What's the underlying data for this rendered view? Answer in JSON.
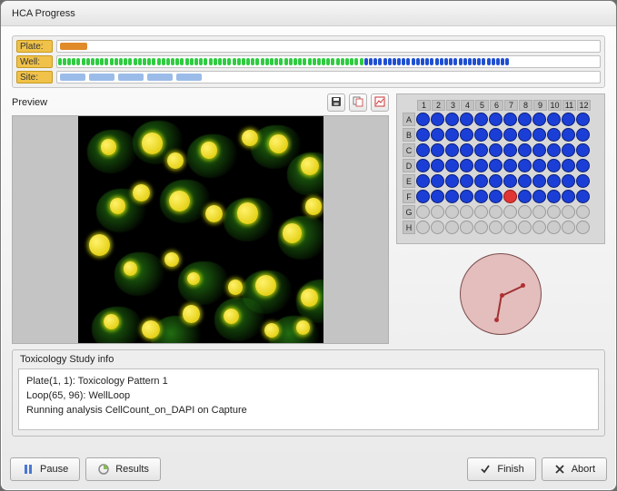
{
  "window": {
    "title": "HCA Progress"
  },
  "progress": {
    "plate_label": "Plate:",
    "well_label": "Well:",
    "site_label": "Site:"
  },
  "preview": {
    "label": "Preview",
    "icons": {
      "save": "save-icon",
      "copy": "copy-icon",
      "snapshot": "snapshot-icon"
    }
  },
  "plate": {
    "rows": [
      "A",
      "B",
      "C",
      "D",
      "E",
      "F",
      "G",
      "H"
    ],
    "cols": [
      "1",
      "2",
      "3",
      "4",
      "5",
      "6",
      "7",
      "8",
      "9",
      "10",
      "11",
      "12"
    ],
    "filled_rows": 5,
    "partial_row_cols": 12,
    "current": {
      "row": "F",
      "col": "7"
    }
  },
  "info": {
    "group_title": "Toxicology Study info",
    "line1": "Plate(1, 1): Toxicology Pattern 1",
    "line2": "Loop(65, 96): WellLoop",
    "line3": "",
    "line4": "Running analysis CellCount_on_DAPI on Capture"
  },
  "buttons": {
    "pause": "Pause",
    "results": "Results",
    "finish": "Finish",
    "abort": "Abort"
  },
  "colors": {
    "accent_blue": "#1b3fd6",
    "accent_red": "#e03535",
    "label_bg": "#f0c24a"
  }
}
